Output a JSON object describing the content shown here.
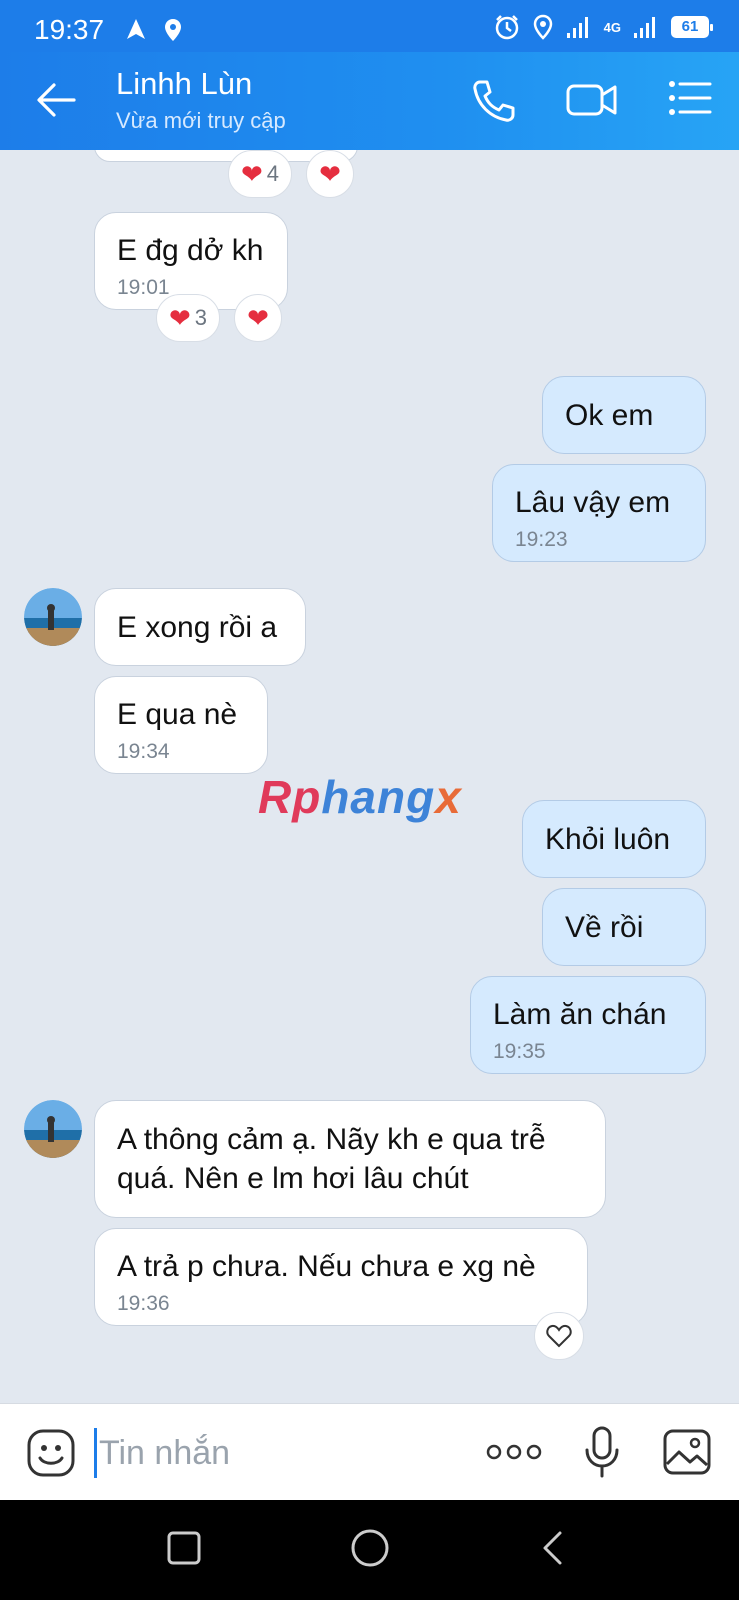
{
  "status_bar": {
    "time": "19:37",
    "network_type": "4G",
    "battery": "61",
    "icons": [
      "navigation-arrow-icon",
      "location-icon",
      "alarm-icon",
      "location-icon",
      "signal-icon",
      "signal-icon",
      "battery-icon"
    ]
  },
  "header": {
    "title": "Linhh Lùn",
    "subtitle": "Vừa mới truy cập",
    "icons": [
      "back-arrow-icon",
      "phone-icon",
      "video-call-icon",
      "menu-icon"
    ]
  },
  "messages": [
    {
      "dir": "in",
      "text": "E đg dở kh",
      "time": "19:01"
    },
    {
      "dir": "out",
      "text": "Ok em"
    },
    {
      "dir": "out",
      "text": "Lâu vậy em",
      "time": "19:23"
    },
    {
      "dir": "in",
      "text": "E xong rồi a"
    },
    {
      "dir": "in",
      "text": "E qua nè",
      "time": "19:34"
    },
    {
      "dir": "out",
      "text": "Khỏi luôn"
    },
    {
      "dir": "out",
      "text": "Về rồi"
    },
    {
      "dir": "out",
      "text": "Làm ăn chán",
      "time": "19:35"
    },
    {
      "dir": "in",
      "lines": [
        "A thông cảm ạ. Nãy kh e qua trễ",
        "quá. Nên e lm hơi lâu chút"
      ]
    },
    {
      "dir": "in",
      "text": "A trả p chưa. Nếu chưa e xg nè",
      "time": "19:36"
    }
  ],
  "reactions": {
    "top_count": "4",
    "msg1_count": "3"
  },
  "watermark": {
    "part_a": "Rp",
    "part_b": "hang",
    "part_c": "x"
  },
  "input": {
    "placeholder": "Tin nhắn",
    "icons": [
      "emoji-icon",
      "more-options-icon",
      "microphone-icon",
      "image-gallery-icon"
    ]
  },
  "colors": {
    "header": "#1d7de9",
    "chat_background": "#e2e8f0",
    "incoming_bubble": "#ffffff",
    "outgoing_bubble": "#d5eafe",
    "heart": "#e52e3f"
  }
}
